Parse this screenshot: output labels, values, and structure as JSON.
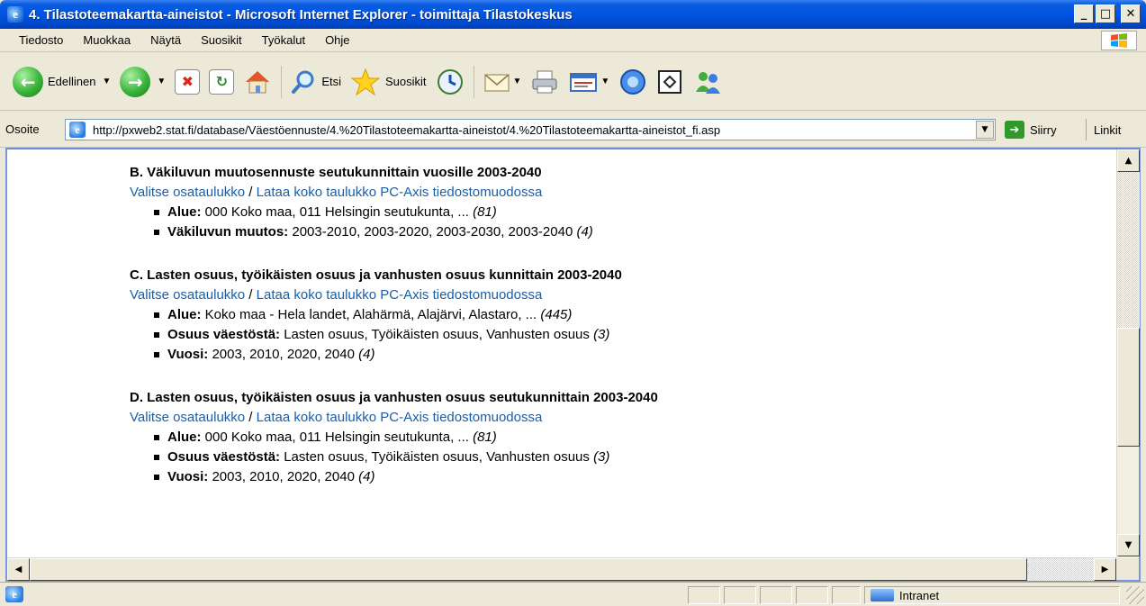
{
  "window": {
    "title": "4. Tilastoteemakartta-aineistot - Microsoft Internet Explorer - toimittaja Tilastokeskus",
    "icon": "ie-icon",
    "controls": [
      "minimize-icon",
      "maximize-icon",
      "close-icon"
    ]
  },
  "menu": {
    "items": [
      "Tiedosto",
      "Muokkaa",
      "Näytä",
      "Suosikit",
      "Työkalut",
      "Ohje"
    ]
  },
  "toolbar": {
    "back_label": "Edellinen",
    "search_label": "Etsi",
    "favorites_label": "Suosikit"
  },
  "address": {
    "label": "Osoite",
    "url": "http://pxweb2.stat.fi/database/Väestöennuste/4.%20Tilastoteemakartta-aineistot/4.%20Tilastoteemakartta-aineistot_fi.asp",
    "go_label": "Siirry",
    "links_label": "Linkit"
  },
  "content": {
    "sections": [
      {
        "title": "B. Väkiluvun muutosennuste seutukunnittain vuosille 2003-2040",
        "link_select": "Valitse osataulukko",
        "separator": " / ",
        "link_download": "Lataa koko taulukko PC-Axis tiedostomuodossa",
        "vars": [
          {
            "key": "Alue:",
            "value": " 000 Koko maa, 011 Helsingin seutukunta, ... ",
            "count": "(81)"
          },
          {
            "key": "Väkiluvun muutos:",
            "value": " 2003-2010, 2003-2020, 2003-2030, 2003-2040 ",
            "count": "(4)"
          }
        ]
      },
      {
        "title": "C. Lasten osuus, työikäisten osuus ja vanhusten osuus kunnittain 2003-2040",
        "link_select": "Valitse osataulukko",
        "separator": " / ",
        "link_download": "Lataa koko taulukko PC-Axis tiedostomuodossa",
        "vars": [
          {
            "key": "Alue:",
            "value": " Koko maa - Hela landet, Alahärmä, Alajärvi, Alastaro, ... ",
            "count": "(445)"
          },
          {
            "key": "Osuus väestöstä:",
            "value": " Lasten osuus, Työikäisten osuus, Vanhusten osuus ",
            "count": "(3)"
          },
          {
            "key": "Vuosi:",
            "value": " 2003, 2010, 2020, 2040 ",
            "count": "(4)"
          }
        ]
      },
      {
        "title": "D. Lasten osuus, työikäisten osuus ja vanhusten osuus seutukunnittain 2003-2040",
        "link_select": "Valitse osataulukko",
        "separator": " / ",
        "link_download": "Lataa koko taulukko PC-Axis tiedostomuodossa",
        "vars": [
          {
            "key": "Alue:",
            "value": " 000 Koko maa, 011 Helsingin seutukunta, ... ",
            "count": "(81)"
          },
          {
            "key": "Osuus väestöstä:",
            "value": " Lasten osuus, Työikäisten osuus, Vanhusten osuus ",
            "count": "(3)"
          },
          {
            "key": "Vuosi:",
            "value": " 2003, 2010, 2020, 2040 ",
            "count": "(4)"
          }
        ]
      }
    ]
  },
  "status": {
    "zone_label": "Intranet"
  },
  "colors": {
    "link": "#1a5fa8",
    "titlebar": "#0054e3"
  }
}
